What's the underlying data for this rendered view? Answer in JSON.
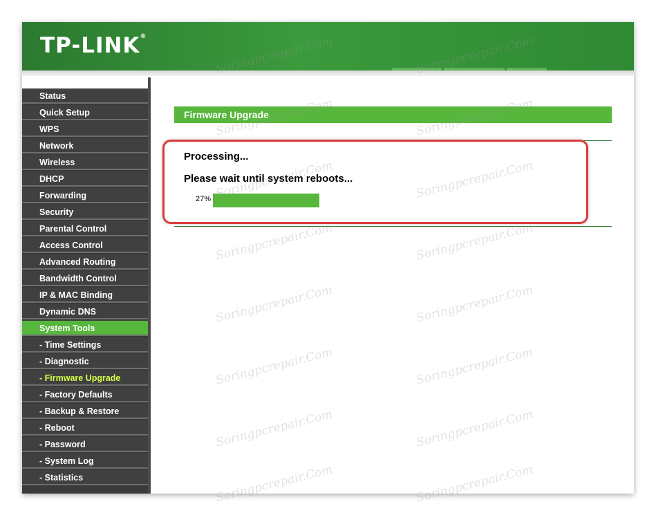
{
  "brand": {
    "logo": "TP-LINK",
    "trademark": "®"
  },
  "colors": {
    "header": "#3b9a3c",
    "accent": "#57b73c",
    "menu_bg": "#404040",
    "current_item": "#d6ff4a",
    "highlight": "#d93b3b"
  },
  "sidebar": {
    "items": [
      {
        "label": "Status",
        "state": "normal"
      },
      {
        "label": "Quick Setup",
        "state": "normal"
      },
      {
        "label": "WPS",
        "state": "normal"
      },
      {
        "label": "Network",
        "state": "normal"
      },
      {
        "label": "Wireless",
        "state": "normal"
      },
      {
        "label": "DHCP",
        "state": "normal"
      },
      {
        "label": "Forwarding",
        "state": "normal"
      },
      {
        "label": "Security",
        "state": "normal"
      },
      {
        "label": "Parental Control",
        "state": "normal"
      },
      {
        "label": "Access Control",
        "state": "normal"
      },
      {
        "label": "Advanced Routing",
        "state": "normal"
      },
      {
        "label": "Bandwidth Control",
        "state": "normal"
      },
      {
        "label": "IP & MAC Binding",
        "state": "normal"
      },
      {
        "label": "Dynamic DNS",
        "state": "normal"
      },
      {
        "label": "System Tools",
        "state": "active"
      },
      {
        "label": "- Time Settings",
        "state": "normal"
      },
      {
        "label": "- Diagnostic",
        "state": "normal"
      },
      {
        "label": "- Firmware Upgrade",
        "state": "current"
      },
      {
        "label": "- Factory Defaults",
        "state": "normal"
      },
      {
        "label": "- Backup & Restore",
        "state": "normal"
      },
      {
        "label": "- Reboot",
        "state": "normal"
      },
      {
        "label": "- Password",
        "state": "normal"
      },
      {
        "label": "- System Log",
        "state": "normal"
      },
      {
        "label": "- Statistics",
        "state": "normal"
      }
    ]
  },
  "main": {
    "section_title": "Firmware Upgrade",
    "processing_text": "Processing...",
    "wait_text": "Please wait until system reboots...",
    "progress": {
      "label": "27%",
      "value": 0.27
    }
  },
  "watermark_text": "Soringpcrepair.Com"
}
